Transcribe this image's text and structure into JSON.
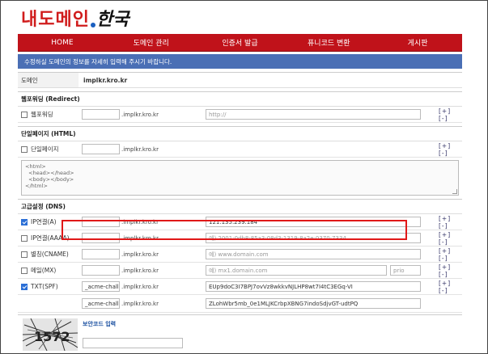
{
  "logo": {
    "brand": "내도메인",
    "tld": "한국"
  },
  "nav": [
    "HOME",
    "도메인 관리",
    "인증서 발급",
    "퓨니코드 변환",
    "게시판"
  ],
  "notice": "수정하실 도메인의 정보를 자세히 입력해 주시기 바랍니다.",
  "domain": {
    "label": "도메인",
    "value": "implkr.kro.kr"
  },
  "redirect": {
    "title": "웹포워딩 (Redirect)",
    "label": "웹포워딩",
    "suffix": ".implkr.kro.kr",
    "placeholder": "http://",
    "pm": "[+] [-]"
  },
  "html_page": {
    "title": "단일페이지 (HTML)",
    "label": "단일페이지",
    "suffix": ".implkr.kro.kr",
    "pm": "[+] [-]",
    "code": [
      "<html>",
      "  <head></head>",
      "  <body></body>",
      "</html>"
    ]
  },
  "dns": {
    "title": "고급설정 (DNS)",
    "records": [
      {
        "label": "IP연결(A)",
        "checked": true,
        "sub": "",
        "suffix": ".implkr.kro.kr",
        "value": "121.135.239.184",
        "placeholder": "",
        "pm": "[+] [-]"
      },
      {
        "label": "IP연결(AAAA)",
        "checked": false,
        "sub": "",
        "suffix": ".implkr.kro.kr",
        "value": "",
        "placeholder": "예) 2001:0db8:85a3:08d3:1319:8a2e:0370:7334",
        "pm": "[+] [-]"
      },
      {
        "label": "별칭(CNAME)",
        "checked": false,
        "sub": "",
        "suffix": ".implkr.kro.kr",
        "value": "",
        "placeholder": "예) www.domain.com",
        "pm": "[+] [-]"
      },
      {
        "label": "메일(MX)",
        "checked": false,
        "sub": "",
        "suffix": ".implkr.kro.kr",
        "value": "",
        "placeholder": "예) mx1.domain.com",
        "prio": "prio",
        "pm": "[+] [-]"
      },
      {
        "label": "TXT(SPF)",
        "checked": true,
        "sub": "_acme-challer",
        "suffix": ".implkr.kro.kr",
        "value": "EUp9doC3I7BPJ7ovVz8wkkvNJLHP8wt7I4tC3EGq-VI",
        "placeholder": "",
        "pm": "[+] [-]"
      },
      {
        "label": "",
        "checked": null,
        "sub": "_acme-challer",
        "suffix": ".implkr.kro.kr",
        "value": "ZLohWbr5mb_0e1MLJKCrbpXBNG7indoSdjvGT-udtPQ",
        "placeholder": "",
        "pm": ""
      }
    ]
  },
  "captcha": {
    "title": "보안코드 입력",
    "text": "1572"
  }
}
